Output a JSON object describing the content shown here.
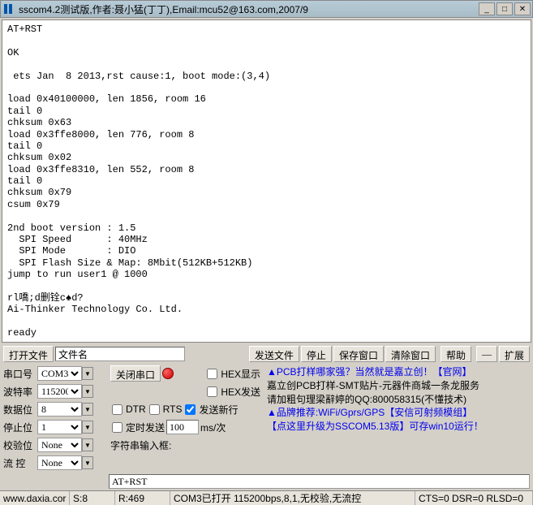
{
  "title": "sscom4.2测试版,作者:聂小猛(丁丁),Email:mcu52@163.com,2007/9",
  "terminal": "AT+RST\n\nOK\n\n ets Jan  8 2013,rst cause:1, boot mode:(3,4)\n\nload 0x40100000, len 1856, room 16\ntail 0\nchksum 0x63\nload 0x3ffe8000, len 776, room 8\ntail 0\nchksum 0x02\nload 0x3ffe8310, len 552, room 8\ntail 0\nchksum 0x79\ncsum 0x79\n\n2nd boot version : 1.5\n  SPI Speed      : 40MHz\n  SPI Mode       : DIO\n  SPI Flash Size & Map: 8Mbit(512KB+512KB)\njump to run user1 @ 1000\n\nrl嘺;d删铨c♠d?\nAi-Thinker Technology Co. Ltd.\n\nready",
  "buttons": {
    "open_file": "打开文件",
    "file_name_label": "文件名",
    "send_file": "发送文件",
    "stop": "停止",
    "save_window": "保存窗口",
    "clear_window": "清除窗口",
    "help": "帮助",
    "dash": "—",
    "expand": "扩展",
    "close_port": "关闭串口"
  },
  "config": {
    "port_label": "串口号",
    "port_value": "COM3",
    "baud_label": "波特率",
    "baud_value": "115200",
    "databits_label": "数据位",
    "databits_value": "8",
    "stopbits_label": "停止位",
    "stopbits_value": "1",
    "parity_label": "校验位",
    "parity_value": "None",
    "flow_label": "流 控",
    "flow_value": "None"
  },
  "checkboxes": {
    "hex_show": "HEX显示",
    "hex_send": "HEX发送",
    "dtr": "DTR",
    "rts": "RTS",
    "send_newline": "发送新行",
    "timed_send": "定时发送",
    "interval_value": "100",
    "interval_unit": "ms/次"
  },
  "info": {
    "line1_a": "▲PCB打样哪家强？当然就是嘉立创！【官网】",
    "line2": "嘉立创PCB打样-SMT贴片-元器件商城一条龙服务",
    "line3": "请加粗句理梁辭婷的QQ:800058315(不懂技术)",
    "line4": "▲品牌推荐:WiFi/Gprs/GPS【安信可射频模组】",
    "line5": "【点这里升级为SSCOM5.13版】可存win10运行！"
  },
  "string_input": {
    "label": "字符串输入框:",
    "value": "AT+RST"
  },
  "statusbar": {
    "url": "www.daxia.cor",
    "s": "S:8",
    "r": "R:469",
    "status": "COM3已打开  115200bps,8,1,无校验,无流控",
    "signals": "CTS=0 DSR=0 RLSD=0"
  }
}
